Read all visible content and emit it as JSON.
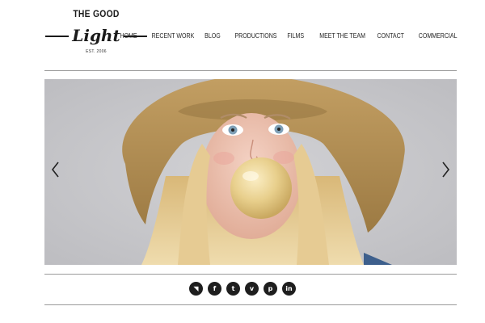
{
  "logo": {
    "line1": "THE GOOD",
    "line2": "Light",
    "line3": "EST. 2006"
  },
  "nav": {
    "items": [
      {
        "label": "HOME"
      },
      {
        "label": "RECENT WORK"
      },
      {
        "label": "BLOG"
      },
      {
        "label": "PRODUCTIONS"
      },
      {
        "label": "FILMS"
      },
      {
        "label": "MEET THE TEAM"
      },
      {
        "label": "CONTACT"
      },
      {
        "label": "COMMERCIAL"
      }
    ]
  },
  "slider": {
    "icons": {
      "prev": "chevron-left-icon",
      "next": "chevron-right-icon"
    },
    "image": "photo of a woman with long blonde hair in a straw sun hat blowing a bubble gum bubble",
    "colors": {
      "background": "#c9c9cc",
      "hat": "#b08d55",
      "hair": "#e2c58e",
      "bubble": "#e8cf8c"
    }
  },
  "social": {
    "icons": [
      {
        "name": "rss-icon",
        "glyph": "◥"
      },
      {
        "name": "facebook-icon",
        "glyph": "f"
      },
      {
        "name": "twitter-icon",
        "glyph": "t"
      },
      {
        "name": "vimeo-icon",
        "glyph": "v"
      },
      {
        "name": "pinterest-icon",
        "glyph": "p"
      },
      {
        "name": "linkedin-icon",
        "glyph": "in"
      }
    ]
  }
}
